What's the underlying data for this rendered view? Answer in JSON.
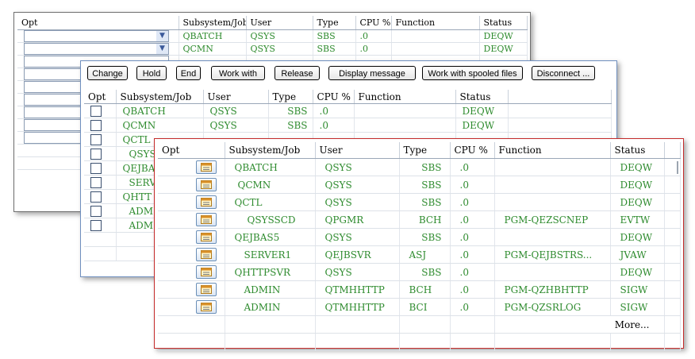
{
  "back": {
    "headers": [
      "Opt",
      "Subsystem/Job",
      "User",
      "Type",
      "CPU %",
      "Function",
      "Status"
    ],
    "rows": [
      {
        "job": "QBATCH",
        "user": "QSYS",
        "type": "SBS",
        "cpu": ".0",
        "func": "",
        "status": "DEQW"
      },
      {
        "job": "QCMN",
        "user": "QSYS",
        "type": "SBS",
        "cpu": ".0",
        "func": "",
        "status": "DEQW"
      }
    ],
    "dropdown_icon": "chevron-down-icon"
  },
  "middle": {
    "buttons": [
      "Change",
      "Hold",
      "End",
      "Work with",
      "Release",
      "Display message",
      "Work with spooled files",
      "Disconnect ..."
    ],
    "headers": [
      "Opt",
      "Subsystem/Job",
      "User",
      "Type",
      "CPU %",
      "Function",
      "Status"
    ],
    "rows": [
      {
        "job": "QBATCH",
        "user": "QSYS",
        "type": "SBS",
        "cpu": ".0",
        "func": "",
        "status": "DEQW"
      },
      {
        "job": "QCMN",
        "user": "QSYS",
        "type": "SBS",
        "cpu": ".0",
        "func": "",
        "status": "DEQW"
      },
      {
        "job": "QCTL"
      },
      {
        "job": "QSYS"
      },
      {
        "job": "QEJBA"
      },
      {
        "job": "SERV"
      },
      {
        "job": "QHTT"
      },
      {
        "job": "ADM"
      },
      {
        "job": "ADM"
      }
    ]
  },
  "front": {
    "headers": [
      "Opt",
      "Subsystem/Job",
      "User",
      "Type",
      "CPU %",
      "Function",
      "Status"
    ],
    "rows": [
      {
        "job": "QBATCH",
        "user": "QSYS",
        "type": "SBS",
        "cpu": ".0",
        "func": "",
        "status": "DEQW"
      },
      {
        "job": "QCMN",
        "user": "QSYS",
        "type": "SBS",
        "cpu": ".0",
        "func": "",
        "status": "DEQW"
      },
      {
        "job": "QCTL",
        "user": "QSYS",
        "type": "SBS",
        "cpu": ".0",
        "func": "",
        "status": "DEQW"
      },
      {
        "job": "QSYSSCD",
        "user": "QPGMR",
        "type": "BCH",
        "cpu": ".0",
        "func": "PGM-QEZSCNEP",
        "status": "EVTW"
      },
      {
        "job": "QEJBAS5",
        "user": "QSYS",
        "type": "SBS",
        "cpu": ".0",
        "func": "",
        "status": "DEQW"
      },
      {
        "job": "SERVER1",
        "user": "QEJBSVR",
        "type": "ASJ",
        "cpu": ".0",
        "func": "PGM-QEJBSTRS...",
        "status": "JVAW"
      },
      {
        "job": "QHTTPSVR",
        "user": "QSYS",
        "type": "SBS",
        "cpu": ".0",
        "func": "",
        "status": "DEQW"
      },
      {
        "job": "ADMIN",
        "user": "QTMHHTTP",
        "type": "BCH",
        "cpu": ".0",
        "func": "PGM-QZHBHTTP",
        "status": "SIGW"
      },
      {
        "job": "ADMIN",
        "user": "QTMHHTTP",
        "type": "BCI",
        "cpu": ".0",
        "func": "PGM-QZSRLOG",
        "status": "SIGW"
      }
    ],
    "more_label": "More...",
    "action_icon": "calendar-icon"
  },
  "colors": {
    "value_text": "#2e8b2e",
    "front_border": "#c42b2b",
    "middle_border": "#6f8fbf"
  }
}
